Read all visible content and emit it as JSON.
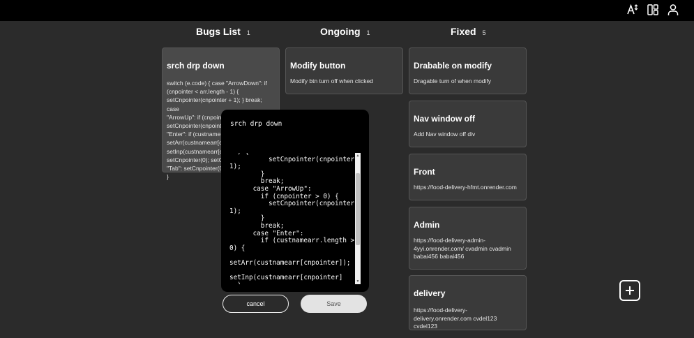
{
  "header": {
    "icons": [
      "text-size-icon",
      "layout-icon",
      "user-icon"
    ]
  },
  "columns": [
    {
      "title": "Bugs List",
      "count": "1"
    },
    {
      "title": "Ongoing",
      "count": "1"
    },
    {
      "title": "Fixed",
      "count": "5"
    }
  ],
  "bugs": [
    {
      "title": "srch drp down",
      "body_lines": [
        "switch (e.code) { case \"ArrowDown\": if",
        "(cnpointer < arr.length - 1) {",
        "setCnpointer(cnpointer + 1); } break; case",
        "\"ArrowUp\": if (cnpointer > 0) {",
        "setCnpointer(cnpoint",
        "\"Enter\": if (custname",
        "setArr(custnamearr[c",
        "setInp(custnamearr[c",
        "setCnpointer(0); setC",
        "\"Tab\": setCnpointer(0",
        "}"
      ]
    }
  ],
  "ongoing": [
    {
      "title": "Modify button",
      "body": "Modify btn turn off when clicked"
    }
  ],
  "fixed": [
    {
      "title": "Drabable on modify",
      "body": "Dragable turn of when modify"
    },
    {
      "title": "Nav window off",
      "body": "Add Nav window off div"
    },
    {
      "title": "Front",
      "body": "https://food-delivery-hfmt.onrender.com"
    },
    {
      "title": "Admin",
      "body": "https://food-delivery-admin-4yyi.onrender.com/ cvadmin cvadmin babai456 babai456"
    },
    {
      "title": "delivery",
      "body": "https://food-delivery-delivery.onrender.com cvdel123 cvdel123"
    }
  ],
  "modal": {
    "title": "srch drp down",
    "code": "  ) {\n          setCnpointer(cnpointer +\n1);\n        }\n        break;\n      case \"ArrowUp\":\n        if (cnpointer > 0) {\n          setCnpointer(cnpointer -\n1);\n        }\n        break;\n      case \"Enter\":\n        if (custnamearr.length >\n0) {\n\nsetArr(custnamearr[cnpointer]);\n\nsetInp(custnamearr[cnpointer]\n  )",
    "cancel_label": "cancel",
    "save_label": "Save"
  },
  "add_button": {
    "icon": "plus-icon"
  }
}
